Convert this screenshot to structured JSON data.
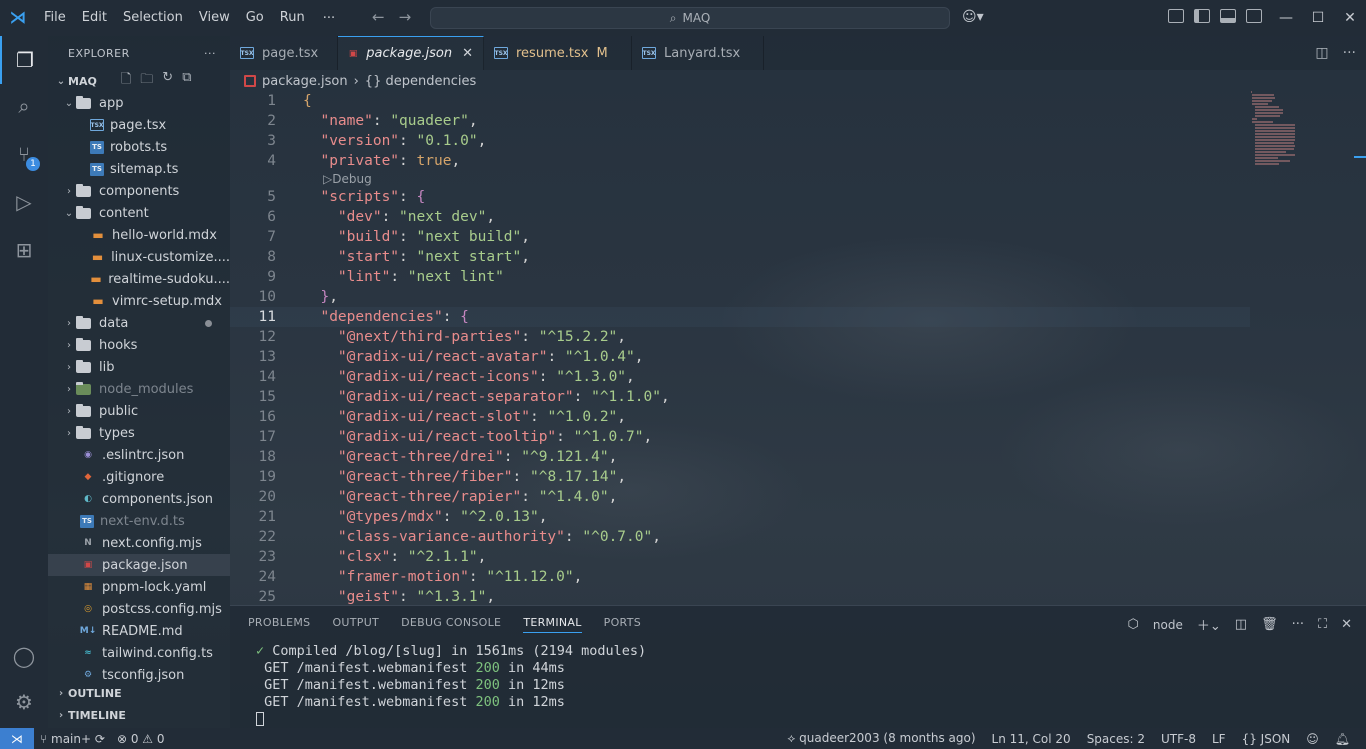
{
  "titlebar": {
    "menu": [
      "File",
      "Edit",
      "Selection",
      "View",
      "Go",
      "Run"
    ],
    "more": "···",
    "search": "MAQ"
  },
  "activity": {
    "scm_badge": "1"
  },
  "sidebar": {
    "header": "EXPLORER",
    "header_more": "···",
    "root": "MAQ",
    "tree": [
      {
        "label": "app",
        "type": "folder-open",
        "indent": 1
      },
      {
        "label": "page.tsx",
        "type": "tsx",
        "indent": 2
      },
      {
        "label": "robots.ts",
        "type": "ts",
        "indent": 2
      },
      {
        "label": "sitemap.ts",
        "type": "ts",
        "indent": 2
      },
      {
        "label": "components",
        "type": "folder",
        "indent": 1
      },
      {
        "label": "content",
        "type": "folder-open",
        "indent": 1
      },
      {
        "label": "hello-world.mdx",
        "type": "mdx",
        "indent": 2
      },
      {
        "label": "linux-customize....",
        "type": "mdx",
        "indent": 2
      },
      {
        "label": "realtime-sudoku....",
        "type": "mdx",
        "indent": 2
      },
      {
        "label": "vimrc-setup.mdx",
        "type": "mdx",
        "indent": 2
      },
      {
        "label": "data",
        "type": "folder",
        "indent": 1,
        "dot": true
      },
      {
        "label": "hooks",
        "type": "folder",
        "indent": 1
      },
      {
        "label": "lib",
        "type": "folder",
        "indent": 1
      },
      {
        "label": "node_modules",
        "type": "folder-node",
        "indent": 1,
        "dim": true
      },
      {
        "label": "public",
        "type": "folder",
        "indent": 1
      },
      {
        "label": "types",
        "type": "folder",
        "indent": 1
      },
      {
        "label": ".eslintrc.json",
        "type": "eslint",
        "indent": 1
      },
      {
        "label": ".gitignore",
        "type": "git",
        "indent": 1
      },
      {
        "label": "components.json",
        "type": "json-comp",
        "indent": 1
      },
      {
        "label": "next-env.d.ts",
        "type": "ts",
        "indent": 1,
        "dim": true
      },
      {
        "label": "next.config.mjs",
        "type": "next",
        "indent": 1
      },
      {
        "label": "package.json",
        "type": "pkg",
        "indent": 1,
        "selected": true
      },
      {
        "label": "pnpm-lock.yaml",
        "type": "pnpm",
        "indent": 1
      },
      {
        "label": "postcss.config.mjs",
        "type": "postcss",
        "indent": 1
      },
      {
        "label": "README.md",
        "type": "md",
        "indent": 1
      },
      {
        "label": "tailwind.config.ts",
        "type": "tailwind",
        "indent": 1
      },
      {
        "label": "tsconfig.json",
        "type": "tsconfig",
        "indent": 1
      }
    ],
    "outline": "OUTLINE",
    "timeline": "TIMELINE"
  },
  "tabs": [
    {
      "label": "page.tsx",
      "icon": "tsx"
    },
    {
      "label": "package.json",
      "icon": "pkg",
      "active": true,
      "close": "✕"
    },
    {
      "label": "resume.tsx",
      "icon": "tsx",
      "modified": "M"
    },
    {
      "label": "Lanyard.tsx",
      "icon": "tsx"
    }
  ],
  "breadcrumb": {
    "file": "package.json",
    "symbol": "{} dependencies"
  },
  "editor": {
    "codelens": "Debug",
    "current_line": 11,
    "lines": [
      {
        "n": "1",
        "t": [
          [
            "b",
            "{"
          ]
        ]
      },
      {
        "n": "2",
        "t": [
          [
            "p",
            "  "
          ],
          [
            "k",
            "\"name\""
          ],
          [
            "p",
            ": "
          ],
          [
            "s",
            "\"quadeer\""
          ],
          [
            "p",
            ","
          ]
        ]
      },
      {
        "n": "3",
        "t": [
          [
            "p",
            "  "
          ],
          [
            "k",
            "\"version\""
          ],
          [
            "p",
            ": "
          ],
          [
            "s",
            "\"0.1.0\""
          ],
          [
            "p",
            ","
          ]
        ]
      },
      {
        "n": "4",
        "t": [
          [
            "p",
            "  "
          ],
          [
            "k",
            "\"private\""
          ],
          [
            "p",
            ": "
          ],
          [
            "kw",
            "true"
          ],
          [
            "p",
            ","
          ]
        ]
      },
      {
        "n": "5",
        "t": [
          [
            "p",
            "  "
          ],
          [
            "k",
            "\"scripts\""
          ],
          [
            "p",
            ": "
          ],
          [
            "bc",
            "{"
          ]
        ]
      },
      {
        "n": "6",
        "t": [
          [
            "p",
            "    "
          ],
          [
            "k",
            "\"dev\""
          ],
          [
            "p",
            ": "
          ],
          [
            "s",
            "\"next dev\""
          ],
          [
            "p",
            ","
          ]
        ]
      },
      {
        "n": "7",
        "t": [
          [
            "p",
            "    "
          ],
          [
            "k",
            "\"build\""
          ],
          [
            "p",
            ": "
          ],
          [
            "s",
            "\"next build\""
          ],
          [
            "p",
            ","
          ]
        ]
      },
      {
        "n": "8",
        "t": [
          [
            "p",
            "    "
          ],
          [
            "k",
            "\"start\""
          ],
          [
            "p",
            ": "
          ],
          [
            "s",
            "\"next start\""
          ],
          [
            "p",
            ","
          ]
        ]
      },
      {
        "n": "9",
        "t": [
          [
            "p",
            "    "
          ],
          [
            "k",
            "\"lint\""
          ],
          [
            "p",
            ": "
          ],
          [
            "s",
            "\"next lint\""
          ]
        ]
      },
      {
        "n": "10",
        "t": [
          [
            "p",
            "  "
          ],
          [
            "bc",
            "}"
          ],
          [
            "p",
            ","
          ]
        ]
      },
      {
        "n": "11",
        "t": [
          [
            "p",
            "  "
          ],
          [
            "k",
            "\"dependencies\""
          ],
          [
            "p",
            ": "
          ],
          [
            "bc",
            "{"
          ]
        ]
      },
      {
        "n": "12",
        "t": [
          [
            "p",
            "    "
          ],
          [
            "k",
            "\"@next/third-parties\""
          ],
          [
            "p",
            ": "
          ],
          [
            "s",
            "\"^15.2.2\""
          ],
          [
            "p",
            ","
          ]
        ]
      },
      {
        "n": "13",
        "t": [
          [
            "p",
            "    "
          ],
          [
            "k",
            "\"@radix-ui/react-avatar\""
          ],
          [
            "p",
            ": "
          ],
          [
            "s",
            "\"^1.0.4\""
          ],
          [
            "p",
            ","
          ]
        ]
      },
      {
        "n": "14",
        "t": [
          [
            "p",
            "    "
          ],
          [
            "k",
            "\"@radix-ui/react-icons\""
          ],
          [
            "p",
            ": "
          ],
          [
            "s",
            "\"^1.3.0\""
          ],
          [
            "p",
            ","
          ]
        ]
      },
      {
        "n": "15",
        "t": [
          [
            "p",
            "    "
          ],
          [
            "k",
            "\"@radix-ui/react-separator\""
          ],
          [
            "p",
            ": "
          ],
          [
            "s",
            "\"^1.1.0\""
          ],
          [
            "p",
            ","
          ]
        ]
      },
      {
        "n": "16",
        "t": [
          [
            "p",
            "    "
          ],
          [
            "k",
            "\"@radix-ui/react-slot\""
          ],
          [
            "p",
            ": "
          ],
          [
            "s",
            "\"^1.0.2\""
          ],
          [
            "p",
            ","
          ]
        ]
      },
      {
        "n": "17",
        "t": [
          [
            "p",
            "    "
          ],
          [
            "k",
            "\"@radix-ui/react-tooltip\""
          ],
          [
            "p",
            ": "
          ],
          [
            "s",
            "\"^1.0.7\""
          ],
          [
            "p",
            ","
          ]
        ]
      },
      {
        "n": "18",
        "t": [
          [
            "p",
            "    "
          ],
          [
            "k",
            "\"@react-three/drei\""
          ],
          [
            "p",
            ": "
          ],
          [
            "s",
            "\"^9.121.4\""
          ],
          [
            "p",
            ","
          ]
        ]
      },
      {
        "n": "19",
        "t": [
          [
            "p",
            "    "
          ],
          [
            "k",
            "\"@react-three/fiber\""
          ],
          [
            "p",
            ": "
          ],
          [
            "s",
            "\"^8.17.14\""
          ],
          [
            "p",
            ","
          ]
        ]
      },
      {
        "n": "20",
        "t": [
          [
            "p",
            "    "
          ],
          [
            "k",
            "\"@react-three/rapier\""
          ],
          [
            "p",
            ": "
          ],
          [
            "s",
            "\"^1.4.0\""
          ],
          [
            "p",
            ","
          ]
        ]
      },
      {
        "n": "21",
        "t": [
          [
            "p",
            "    "
          ],
          [
            "k",
            "\"@types/mdx\""
          ],
          [
            "p",
            ": "
          ],
          [
            "s",
            "\"^2.0.13\""
          ],
          [
            "p",
            ","
          ]
        ]
      },
      {
        "n": "22",
        "t": [
          [
            "p",
            "    "
          ],
          [
            "k",
            "\"class-variance-authority\""
          ],
          [
            "p",
            ": "
          ],
          [
            "s",
            "\"^0.7.0\""
          ],
          [
            "p",
            ","
          ]
        ]
      },
      {
        "n": "23",
        "t": [
          [
            "p",
            "    "
          ],
          [
            "k",
            "\"clsx\""
          ],
          [
            "p",
            ": "
          ],
          [
            "s",
            "\"^2.1.1\""
          ],
          [
            "p",
            ","
          ]
        ]
      },
      {
        "n": "24",
        "t": [
          [
            "p",
            "    "
          ],
          [
            "k",
            "\"framer-motion\""
          ],
          [
            "p",
            ": "
          ],
          [
            "s",
            "\"^11.12.0\""
          ],
          [
            "p",
            ","
          ]
        ]
      },
      {
        "n": "25",
        "t": [
          [
            "p",
            "    "
          ],
          [
            "k",
            "\"geist\""
          ],
          [
            "p",
            ": "
          ],
          [
            "s",
            "\"^1.3.1\""
          ],
          [
            "p",
            ","
          ]
        ]
      }
    ]
  },
  "panel": {
    "tabs": [
      "PROBLEMS",
      "OUTPUT",
      "DEBUG CONSOLE",
      "TERMINAL",
      "PORTS"
    ],
    "active_tab": "TERMINAL",
    "shell": "node",
    "terminal": [
      {
        "check": "✓",
        "text": " Compiled /blog/[slug] in 1561ms (2194 modules)"
      },
      {
        "pre": " GET /manifest.webmanifest ",
        "code": "200",
        "post": " in 44ms"
      },
      {
        "pre": " GET /manifest.webmanifest ",
        "code": "200",
        "post": " in 12ms"
      },
      {
        "pre": " GET /manifest.webmanifest ",
        "code": "200",
        "post": " in 12ms"
      }
    ]
  },
  "statusbar": {
    "branch": "main+",
    "errors": "0",
    "warnings": "0",
    "blame": "quadeer2003 (8 months ago)",
    "position": "Ln 11, Col 20",
    "spaces": "Spaces: 2",
    "encoding": "UTF-8",
    "eol": "LF",
    "language": "{} JSON"
  }
}
